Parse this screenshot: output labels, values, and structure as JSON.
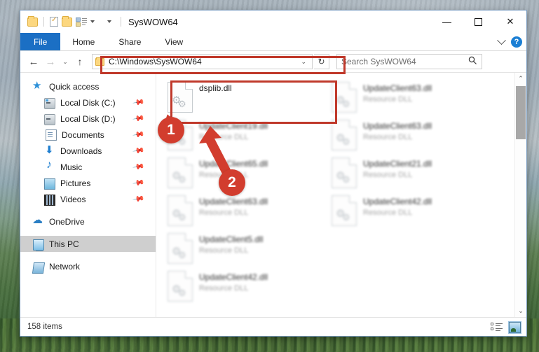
{
  "window": {
    "title": "SysWOW64",
    "quick_access_toolbar": [
      {
        "name": "folder-properties-icon",
        "label": ""
      },
      {
        "name": "properties-icon",
        "label": ""
      },
      {
        "name": "new-folder-icon",
        "label": ""
      },
      {
        "name": "customize-quick-access-icon",
        "label": ""
      }
    ],
    "controls": {
      "minimize": "—",
      "maximize": "☐",
      "close": "✕"
    }
  },
  "ribbon": {
    "tabs": [
      {
        "label": "File",
        "active": true
      },
      {
        "label": "Home",
        "active": false
      },
      {
        "label": "Share",
        "active": false
      },
      {
        "label": "View",
        "active": false
      }
    ],
    "collapse_icon": "chevron-down-icon",
    "help_label": "?"
  },
  "navbar": {
    "back": "←",
    "forward": "→",
    "history": "⌄",
    "up": "↑",
    "address_value": "C:\\Windows\\SysWOW64",
    "address_dropdown": "⌄",
    "refresh": "↻",
    "search_placeholder": "Search SysWOW64",
    "search_icon": "⚲"
  },
  "sidebar": {
    "items": [
      {
        "label": "Quick access",
        "icon": "star-icon",
        "indent": false,
        "pinned": false,
        "selected": false
      },
      {
        "label": "Local Disk (C:)",
        "icon": "disk-icon",
        "indent": true,
        "pinned": true,
        "selected": false
      },
      {
        "label": "Local Disk (D:)",
        "icon": "disk-icon",
        "indent": true,
        "pinned": true,
        "selected": false
      },
      {
        "label": "Documents",
        "icon": "documents-icon",
        "indent": true,
        "pinned": true,
        "selected": false
      },
      {
        "label": "Downloads",
        "icon": "downloads-icon",
        "indent": true,
        "pinned": true,
        "selected": false
      },
      {
        "label": "Music",
        "icon": "music-icon",
        "indent": true,
        "pinned": true,
        "selected": false
      },
      {
        "label": "Pictures",
        "icon": "pictures-icon",
        "indent": true,
        "pinned": true,
        "selected": false
      },
      {
        "label": "Videos",
        "icon": "videos-icon",
        "indent": true,
        "pinned": true,
        "selected": false
      },
      {
        "label": "OneDrive",
        "icon": "cloud-icon",
        "indent": false,
        "pinned": false,
        "selected": false
      },
      {
        "label": "This PC",
        "icon": "pc-icon",
        "indent": false,
        "pinned": false,
        "selected": true
      },
      {
        "label": "Network",
        "icon": "network-icon",
        "indent": false,
        "pinned": false,
        "selected": false
      }
    ],
    "pin_glyph": "📌"
  },
  "files": {
    "column_left": [
      {
        "name": "dsplib.dll",
        "sub": "",
        "blurred": false,
        "selected": true
      },
      {
        "name": "UpdateClient19.dll",
        "sub": "Resource DLL",
        "blurred": true,
        "selected": false
      },
      {
        "name": "UpdateClient65.dll",
        "sub": "Resource DLL",
        "blurred": true,
        "selected": false
      },
      {
        "name": "UpdateClient63.dll",
        "sub": "Resource DLL",
        "blurred": true,
        "selected": false
      },
      {
        "name": "UpdateClient5.dll",
        "sub": "Resource DLL",
        "blurred": true,
        "selected": false
      }
    ],
    "column_right": [
      {
        "name": "UpdateClient42.dll",
        "sub": "Resource DLL",
        "blurred": true,
        "selected": false
      },
      {
        "name": "UpdateClient63.dll",
        "sub": "Resource DLL",
        "blurred": true,
        "selected": false
      },
      {
        "name": "UpdateClient63.dll",
        "sub": "Resource DLL",
        "blurred": true,
        "selected": false
      },
      {
        "name": "UpdateClient21.dll",
        "sub": "Resource DLL",
        "blurred": true,
        "selected": false
      },
      {
        "name": "UpdateClient42.dll",
        "sub": "Resource DLL",
        "blurred": true,
        "selected": false
      }
    ],
    "scrollbar": {
      "up": "⌃",
      "down": "⌄"
    }
  },
  "status": {
    "item_count": "158 items",
    "view_details": "details-view-button",
    "view_large_icons": "large-icons-view-button"
  },
  "annotations": {
    "badges": [
      {
        "label": "1"
      },
      {
        "label": "2"
      }
    ],
    "accent_color": "#c0392b",
    "badge_color": "#d23d2e"
  }
}
